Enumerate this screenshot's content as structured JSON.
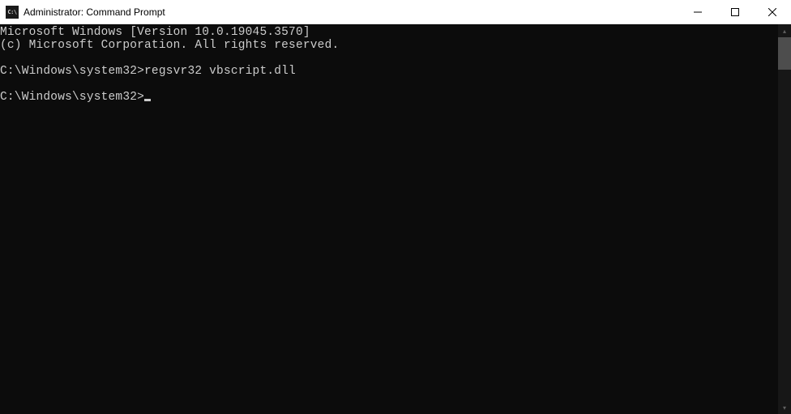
{
  "window": {
    "title": "Administrator: Command Prompt",
    "icon_label": "C:\\"
  },
  "console": {
    "line1": "Microsoft Windows [Version 10.0.19045.3570]",
    "line2": "(c) Microsoft Corporation. All rights reserved.",
    "blank1": "",
    "prompt1": "C:\\Windows\\system32>",
    "command1": "regsvr32 vbscript.dll",
    "blank2": "",
    "prompt2": "C:\\Windows\\system32>"
  }
}
